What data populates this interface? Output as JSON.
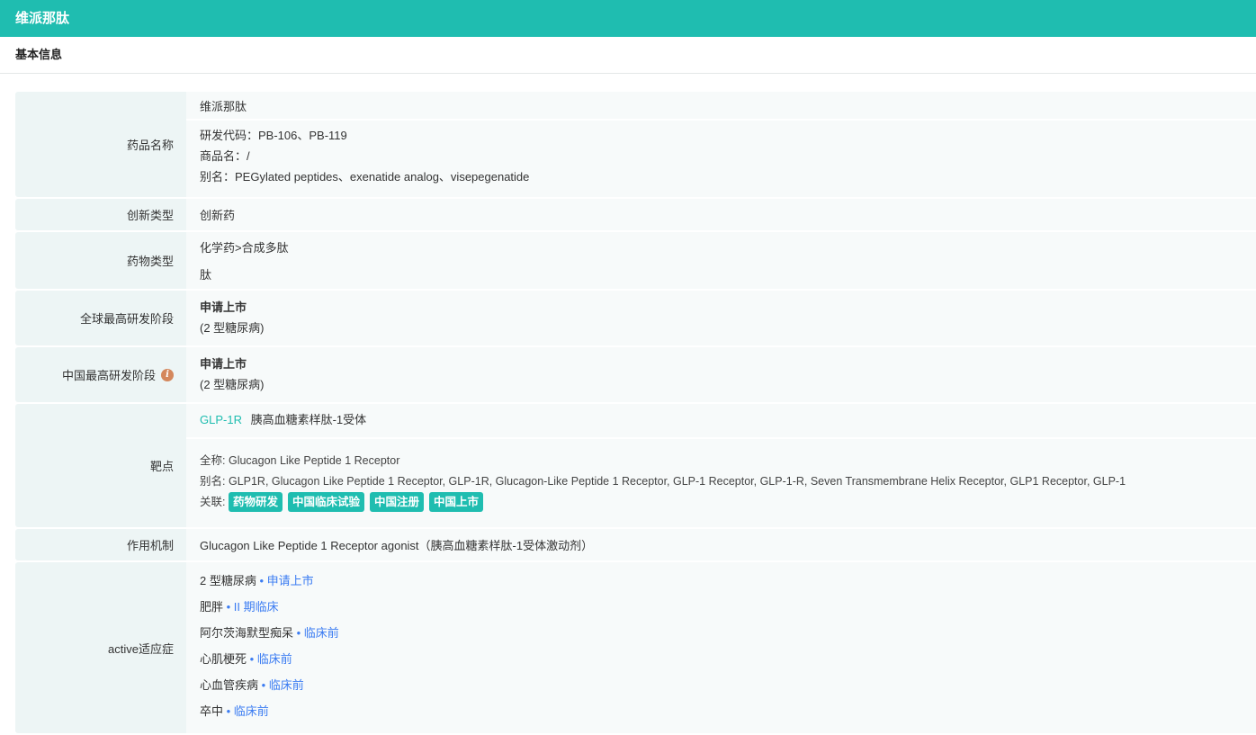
{
  "header": {
    "title": "维派那肽"
  },
  "section": {
    "title": "基本信息"
  },
  "rows": {
    "name": {
      "label": "药品名称",
      "value": "维派那肽",
      "code": "研发代码：PB-106、PB-119",
      "trade": "商品名：/",
      "alias": "别名：PEGylated peptides、exenatide analog、visepegenatide"
    },
    "innovation": {
      "label": "创新类型",
      "value": "创新药"
    },
    "drug_type": {
      "label": "药物类型",
      "values": [
        "化学药>合成多肽",
        "肽"
      ]
    },
    "global_stage": {
      "label": "全球最高研发阶段",
      "stage": "申请上市",
      "indication": "(2 型糖尿病)"
    },
    "china_stage": {
      "label": "中国最高研发阶段",
      "icon": "info-icon",
      "stage": "申请上市",
      "indication": "(2 型糖尿病)"
    },
    "target": {
      "label": "靶点",
      "symbol": "GLP-1R",
      "name": "胰高血糖素样肽-1受体",
      "full_name_label": "全称:",
      "full_name": "Glucagon Like Peptide 1 Receptor",
      "alias_label": "别名:",
      "alias": "GLP1R, Glucagon Like Peptide 1 Receptor, GLP-1R, Glucagon-Like Peptide 1 Receptor, GLP-1 Receptor, GLP-1-R, Seven Transmembrane Helix Receptor, GLP1 Receptor, GLP-1",
      "related_label": "关联:",
      "tags": [
        "药物研发",
        "中国临床试验",
        "中国注册",
        "中国上市"
      ]
    },
    "mechanism": {
      "label": "作用机制",
      "value": "Glucagon Like Peptide 1 Receptor agonist（胰高血糖素样肽-1受体激动剂）"
    },
    "indications": {
      "label": "active适应症",
      "items": [
        {
          "name": "2 型糖尿病",
          "stage": "申请上市"
        },
        {
          "name": "肥胖",
          "stage": "II 期临床"
        },
        {
          "name": "阿尔茨海默型痴呆",
          "stage": "临床前"
        },
        {
          "name": "心肌梗死",
          "stage": "临床前"
        },
        {
          "name": "心血管疾病",
          "stage": "临床前"
        },
        {
          "name": "卒中",
          "stage": "临床前"
        }
      ]
    }
  },
  "colors": {
    "accent": "#1fbdb0",
    "stage": "#3b7cf2",
    "info": "#d4875c"
  }
}
